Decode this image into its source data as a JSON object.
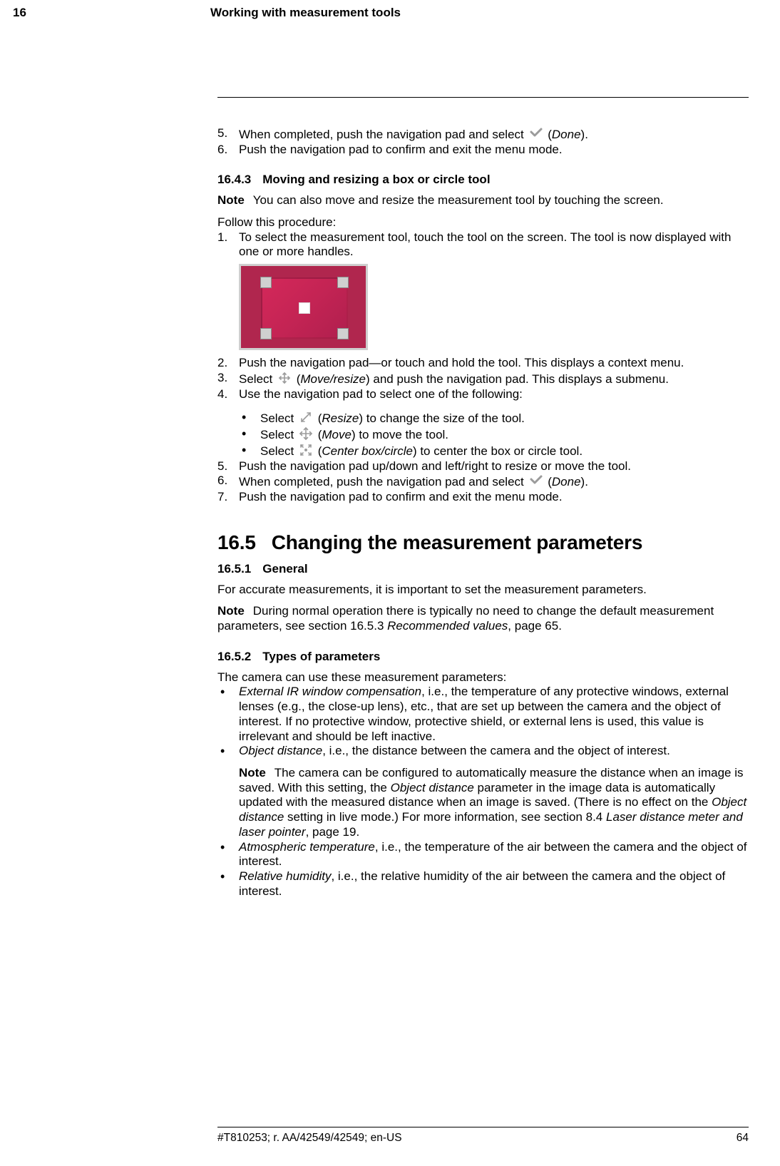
{
  "header": {
    "chapter_number": "16",
    "chapter_title": "Working with measurement tools"
  },
  "footer": {
    "doc_id": "#T810253; r. AA/42549/42549; en-US",
    "page_number": "64"
  },
  "section_16_5": {
    "number": "16.5",
    "title": "Changing the measurement parameters"
  },
  "sub_16_4_3": {
    "num": "16.4.3",
    "title": "Moving and resizing a box or circle tool"
  },
  "sub_16_5_1": {
    "num": "16.5.1",
    "title": "General"
  },
  "sub_16_5_2": {
    "num": "16.5.2",
    "title": "Types of parameters"
  },
  "icons": {
    "done": "Done",
    "move_resize": "Move/resize",
    "resize": "Resize",
    "move": "Move",
    "center": "Center box/circle"
  },
  "text": {
    "top5_pre": "When completed, push the navigation pad and select ",
    "top5_post": " (",
    "top5_end": ").",
    "top6": "Push the navigation pad to confirm and exit the menu mode.",
    "note1_label": "Note",
    "note1_body": "You can also move and resize the measurement tool by touching the screen.",
    "follow": "Follow this procedure:",
    "s1": "To select the measurement tool, touch the tool on the screen. The tool is now displayed with one or more handles.",
    "s2": "Push the navigation pad—or touch and hold the tool. This displays a context menu.",
    "s3_pre": "Select ",
    "s3_mid": " (",
    "s3_post": ") and push the navigation pad. This displays a submenu.",
    "s4": "Use the navigation pad to select one of the following:",
    "s4a_pre": "Select ",
    "s4a_mid": " (",
    "s4a_post": ") to change the size of the tool.",
    "s4b_pre": "Select ",
    "s4b_mid": " (",
    "s4b_post": ") to move the tool.",
    "s4c_pre": "Select ",
    "s4c_mid": " (",
    "s4c_post": ") to center the box or circle tool.",
    "s5": "Push the navigation pad up/down and left/right to resize or move the tool.",
    "s6_pre": "When completed, push the navigation pad and select ",
    "s6_mid": " (",
    "s6_post": ").",
    "s7": "Push the navigation pad to confirm and exit the menu mode.",
    "g1": "For accurate measurements, it is important to set the measurement parameters.",
    "g2_label": "Note",
    "g2_a": "During normal operation there is typically no need to change the default measurement parameters, see section 16.5.3 ",
    "g2_b": "Recommended values",
    "g2_c": ", page 65.",
    "p_intro": "The camera can use these measurement parameters:",
    "p1_a": "External IR window compensation",
    "p1_b": ", i.e., the temperature of any protective windows, external lenses (e.g., the close-up lens), etc., that are set up between the camera and the object of interest. If no protective window, protective shield, or external lens is used, this value is irrelevant and should be left inactive.",
    "p2_a": "Object distance",
    "p2_b": ", i.e., the distance between the camera and the object of interest.",
    "p2_note_label": "Note",
    "p2_note_a": "The camera can be configured to automatically measure the distance when an image is saved. With this setting, the ",
    "p2_note_b": "Object distance",
    "p2_note_c": " parameter in the image data is automatically updated with the measured distance when an image is saved. (There is no effect on the ",
    "p2_note_d": "Object distance",
    "p2_note_e": " setting in live mode.) For more information, see section 8.4 ",
    "p2_note_f": "Laser distance meter and laser pointer",
    "p2_note_g": ", page 19.",
    "p3_a": "Atmospheric temperature",
    "p3_b": ", i.e., the temperature of the air between the camera and the object of interest.",
    "p4_a": "Relative humidity",
    "p4_b": ", i.e., the relative humidity of the air between the camera and the object of interest."
  },
  "numbers": {
    "n5": "5.",
    "n6": "6.",
    "n1": "1.",
    "n2": "2.",
    "n3": "3.",
    "n4": "4.",
    "n7": "7."
  }
}
